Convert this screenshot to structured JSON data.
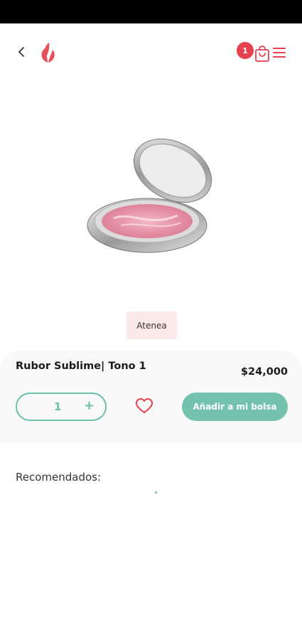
{
  "header": {
    "cart_count": "1"
  },
  "product": {
    "brand": "Atenea",
    "name": "Rubor Sublime| Tono 1",
    "price": "$24,000",
    "quantity": "1",
    "quantity_increment": "+"
  },
  "actions": {
    "add_to_bag_label": "Añadir a mi bolsa"
  },
  "recommendations": {
    "title": "Recomendados:"
  },
  "colors": {
    "accent": "#73c2ad",
    "badge": "#e5414f",
    "brand_chip_bg": "#fbe9ea"
  }
}
